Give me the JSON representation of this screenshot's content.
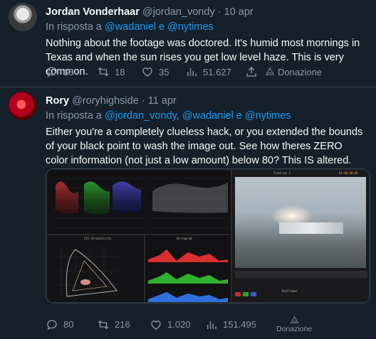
{
  "tweet1": {
    "name": "Jordan Vonderhaar",
    "handle": "@jordan_vondy",
    "dot": "·",
    "time": "10 apr",
    "reply_prefix": "In risposta a",
    "reply_mentions": "@wadaniel e @nytimes",
    "text": "Nothing about the footage was doctored. It's humid most mornings in Texas and when the sun rises you get low level haze. This is very common.",
    "stats": {
      "replies": "68",
      "retweets": "18",
      "likes": "35",
      "views": "51.627",
      "donate": "Donazione"
    }
  },
  "tweet2": {
    "name": "Rory",
    "handle": "@roryhighside",
    "dot": "·",
    "time": "11 apr",
    "reply_prefix": "In risposta a",
    "mention1": "@jordan_vondy",
    "comma": ",",
    "mention2": "@wadaniel e @nytimes",
    "text": "Either you're a completely clueless hack, or you extended the bounds of your black point to wash the image out. See how theres ZERO color information (not just a low amount) below 80? This IS altered.",
    "media": {
      "timeline_label": "Timeline 1",
      "chromaticity_label": "CIE Chromaticity",
      "histogram_label": "Histogram",
      "timecode": "01:00:00:00",
      "node_label": "Keyframes"
    },
    "stats": {
      "replies": "80",
      "retweets": "216",
      "likes": "1.020",
      "views": "151.495",
      "donate": "Donazione"
    }
  },
  "colors": {
    "background": "#15202b",
    "text": "#f7f9f9",
    "muted": "#8b98a5",
    "accent": "#1d9bf0",
    "divider": "#38444d"
  },
  "icons": [
    "reply-icon",
    "retweet-icon",
    "like-icon",
    "views-icon",
    "share-icon",
    "donate-icon"
  ]
}
